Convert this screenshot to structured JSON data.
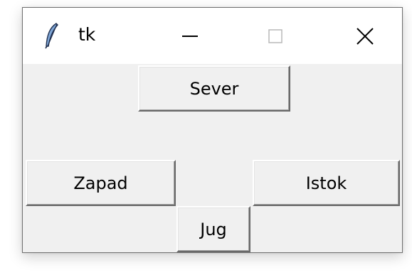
{
  "window": {
    "title": "tk",
    "icon": "feather-icon"
  },
  "caption_buttons": {
    "minimize_icon": "minimize-icon",
    "maximize_icon": "maximize-icon",
    "close_icon": "close-icon"
  },
  "buttons": {
    "north": "Sever",
    "west": "Zapad",
    "east": "Istok",
    "south": "Jug"
  },
  "colors": {
    "client_background": "#f0f0f0",
    "titlebar_background": "#ffffff"
  }
}
